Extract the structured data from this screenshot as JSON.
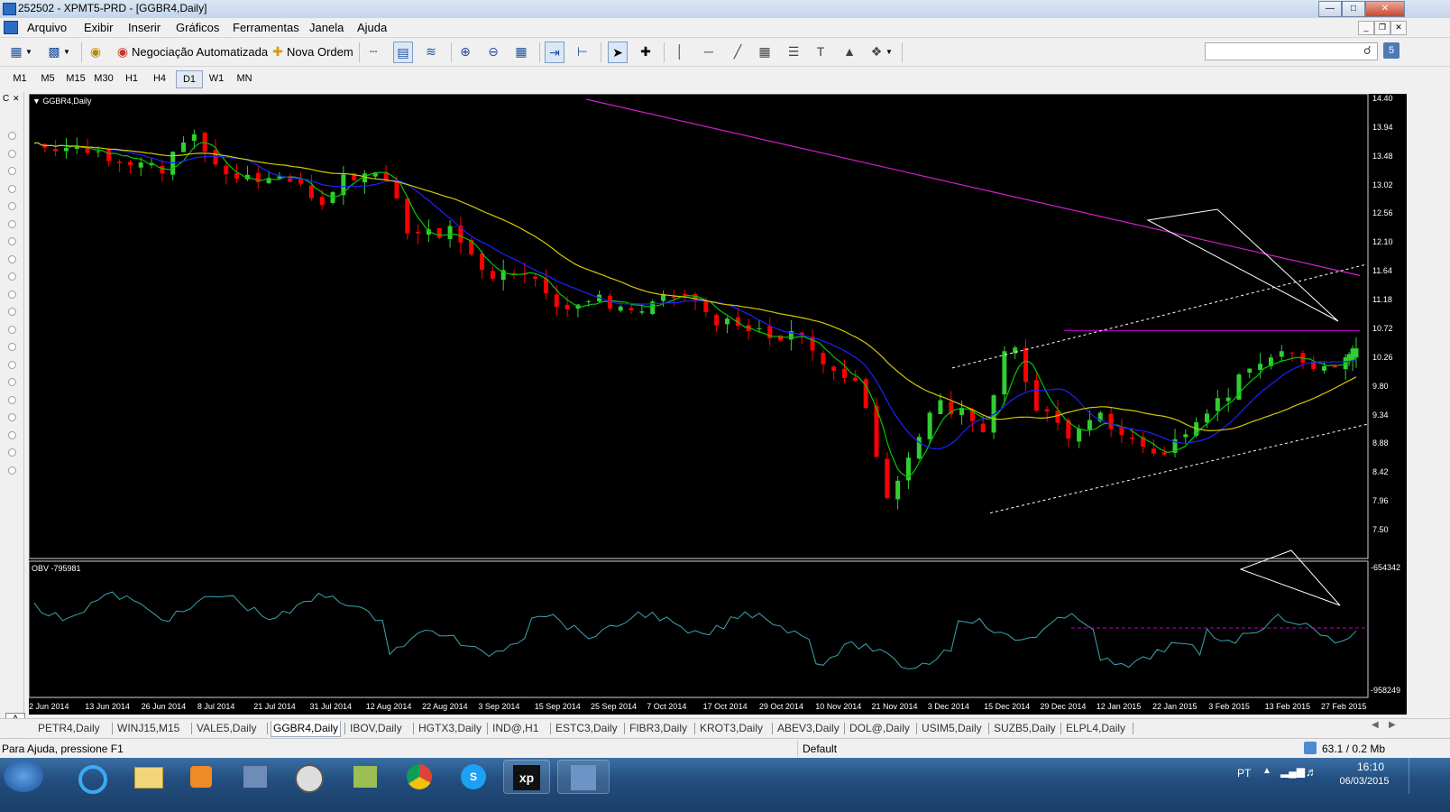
{
  "window": {
    "title": "252502 - XPMT5-PRD - [GGBR4,Daily]"
  },
  "menu": [
    "Arquivo",
    "Exibir",
    "Inserir",
    "Gráficos",
    "Ferramentas",
    "Janela",
    "Ajuda"
  ],
  "toolbar": {
    "auto_trading_label": "Negociação Automatizada",
    "new_order_label": "Nova Ordem",
    "search_placeholder": ""
  },
  "timeframes": [
    "M1",
    "M5",
    "M15",
    "M30",
    "H1",
    "H4",
    "D1",
    "W1",
    "MN"
  ],
  "active_timeframe": "D1",
  "chart": {
    "symbol_label": "GGBR4,Daily",
    "obv_label": "OBV -795981",
    "price_ticks": [
      "14.40",
      "13.94",
      "13.48",
      "13.02",
      "12.56",
      "12.10",
      "11.64",
      "11.18",
      "10.72",
      "10.26",
      "9.80",
      "9.34",
      "8.88",
      "8.42",
      "7.96",
      "7.50"
    ],
    "obv_ticks": [
      "-654342",
      "-958249"
    ],
    "date_ticks": [
      "2 Jun 2014",
      "13 Jun 2014",
      "26 Jun 2014",
      "8 Jul 2014",
      "21 Jul 2014",
      "31 Jul 2014",
      "12 Aug 2014",
      "22 Aug 2014",
      "3 Sep 2014",
      "15 Sep 2014",
      "25 Sep 2014",
      "7 Oct 2014",
      "17 Oct 2014",
      "29 Oct 2014",
      "10 Nov 2014",
      "21 Nov 2014",
      "3 Dec 2014",
      "15 Dec 2014",
      "29 Dec 2014",
      "12 Jan 2015",
      "22 Jan 2015",
      "3 Feb 2015",
      "13 Feb 2015",
      "27 Feb 2015"
    ],
    "colors": {
      "bull": "#32cd32",
      "bear": "#ff0000",
      "ma_fast": "#00c800",
      "ma_mid": "#2020ff",
      "ma_slow": "#d4c800",
      "ma_long": "#d01fd0",
      "obv": "#3aa6b0",
      "resistance": "#c000c0"
    }
  },
  "chart_data": {
    "type": "line",
    "title": "GGBR4,Daily",
    "xlabel": "",
    "ylabel": "",
    "ylim": [
      7.5,
      14.4
    ],
    "close_start": 13.65,
    "close_end": 10.7,
    "annotations": [
      "resistance near 10.70",
      "ascending channel from 15 Dec 2014"
    ]
  },
  "tabs": [
    "PETR4,Daily",
    "WINJ15,M15",
    "VALE5,Daily",
    "GGBR4,Daily",
    "IBOV,Daily",
    "HGTX3,Daily",
    "IND@,H1",
    "ESTC3,Daily",
    "FIBR3,Daily",
    "KROT3,Daily",
    "ABEV3,Daily",
    "DOL@,Daily",
    "USIM5,Daily",
    "SUZB5,Daily",
    "ELPL4,Daily"
  ],
  "active_tab": "GGBR4,Daily",
  "status": {
    "help": "Para Ajuda, pressione F1",
    "profile": "Default",
    "traffic": "63.1 / 0.2 Mb"
  },
  "taskbar": {
    "lang": "PT",
    "time": "16:10",
    "date": "06/03/2015"
  }
}
